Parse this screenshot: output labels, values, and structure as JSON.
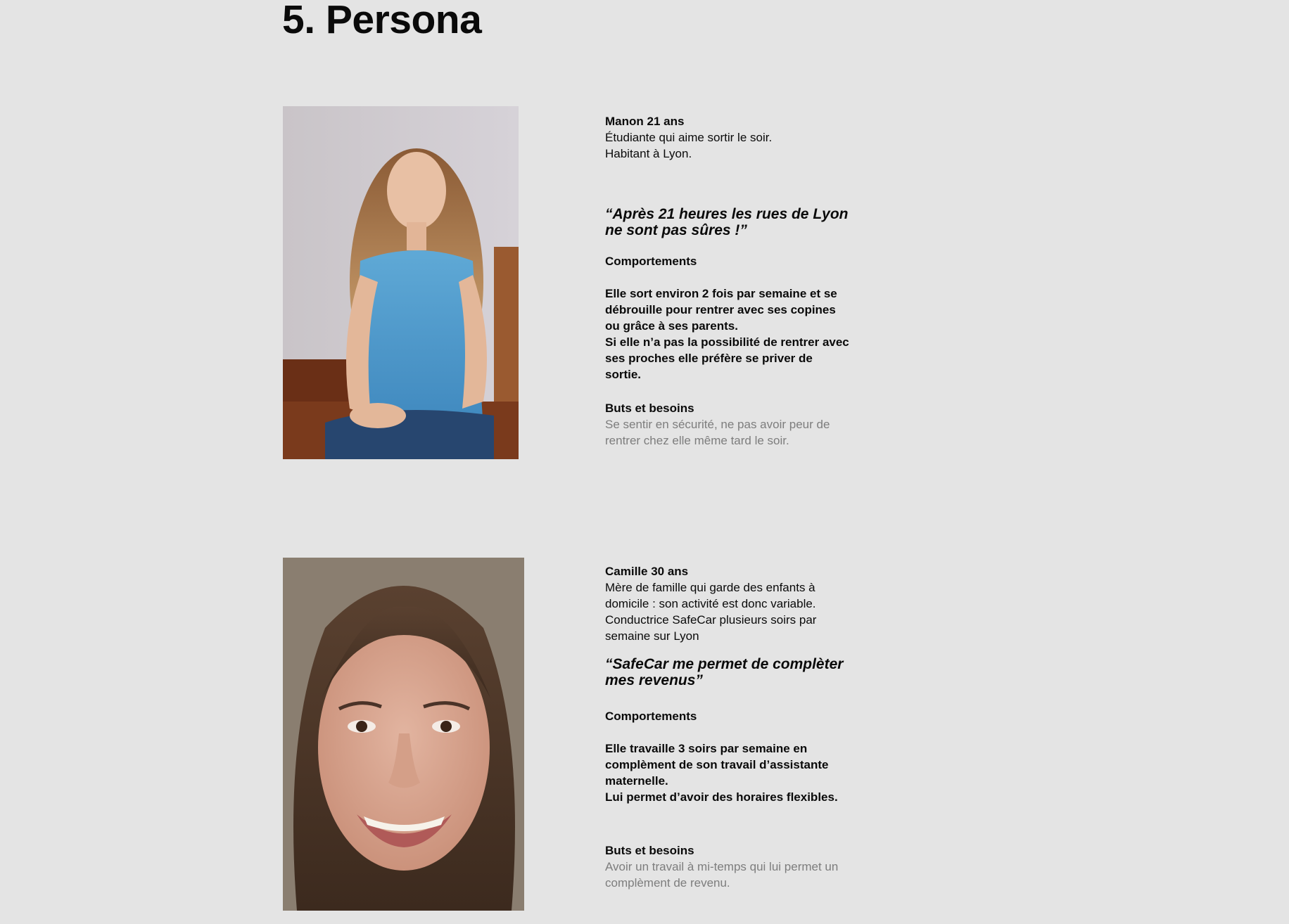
{
  "page": {
    "title": "5. Persona"
  },
  "personas": [
    {
      "name_age": "Manon 21 ans",
      "intro_lines": [
        "Étudiante qui aime sortir le soir.",
        "Habitant à Lyon."
      ],
      "quote_lines": [
        "“Après 21 heures les rues de Lyon",
        "ne sont pas sûres !”"
      ],
      "behaviors_heading": "Comportements",
      "behaviors_lines": [
        "Elle sort environ 2 fois par semaine et se",
        "débrouille pour rentrer avec ses copines",
        "ou grâce à ses parents.",
        "Si elle n’a pas la possibilité de rentrer avec",
        "ses proches elle préfère se priver de",
        "sortie."
      ],
      "goals_heading": "Buts et besoins",
      "goals_lines": [
        "Se sentir en sécurité, ne pas avoir peur de",
        "rentrer chez elle même tard le soir."
      ]
    },
    {
      "name_age": "Camille 30 ans",
      "intro_lines": [
        "Mère de famille qui garde des enfants à",
        "domicile : son activité est donc variable.",
        "Conductrice SafeCar plusieurs soirs par",
        "semaine sur Lyon"
      ],
      "quote_lines": [
        "“SafeCar me permet de complèter",
        "mes revenus”"
      ],
      "behaviors_heading": "Comportements",
      "behaviors_lines": [
        "Elle travaille 3 soirs par semaine en",
        "complèment de son travail d’assistante",
        "maternelle.",
        "Lui permet d’avoir des horaires flexibles."
      ],
      "goals_heading": "Buts et besoins",
      "goals_lines": [
        "Avoir un travail à mi-temps qui lui permet un",
        "complèment de revenu."
      ]
    }
  ]
}
